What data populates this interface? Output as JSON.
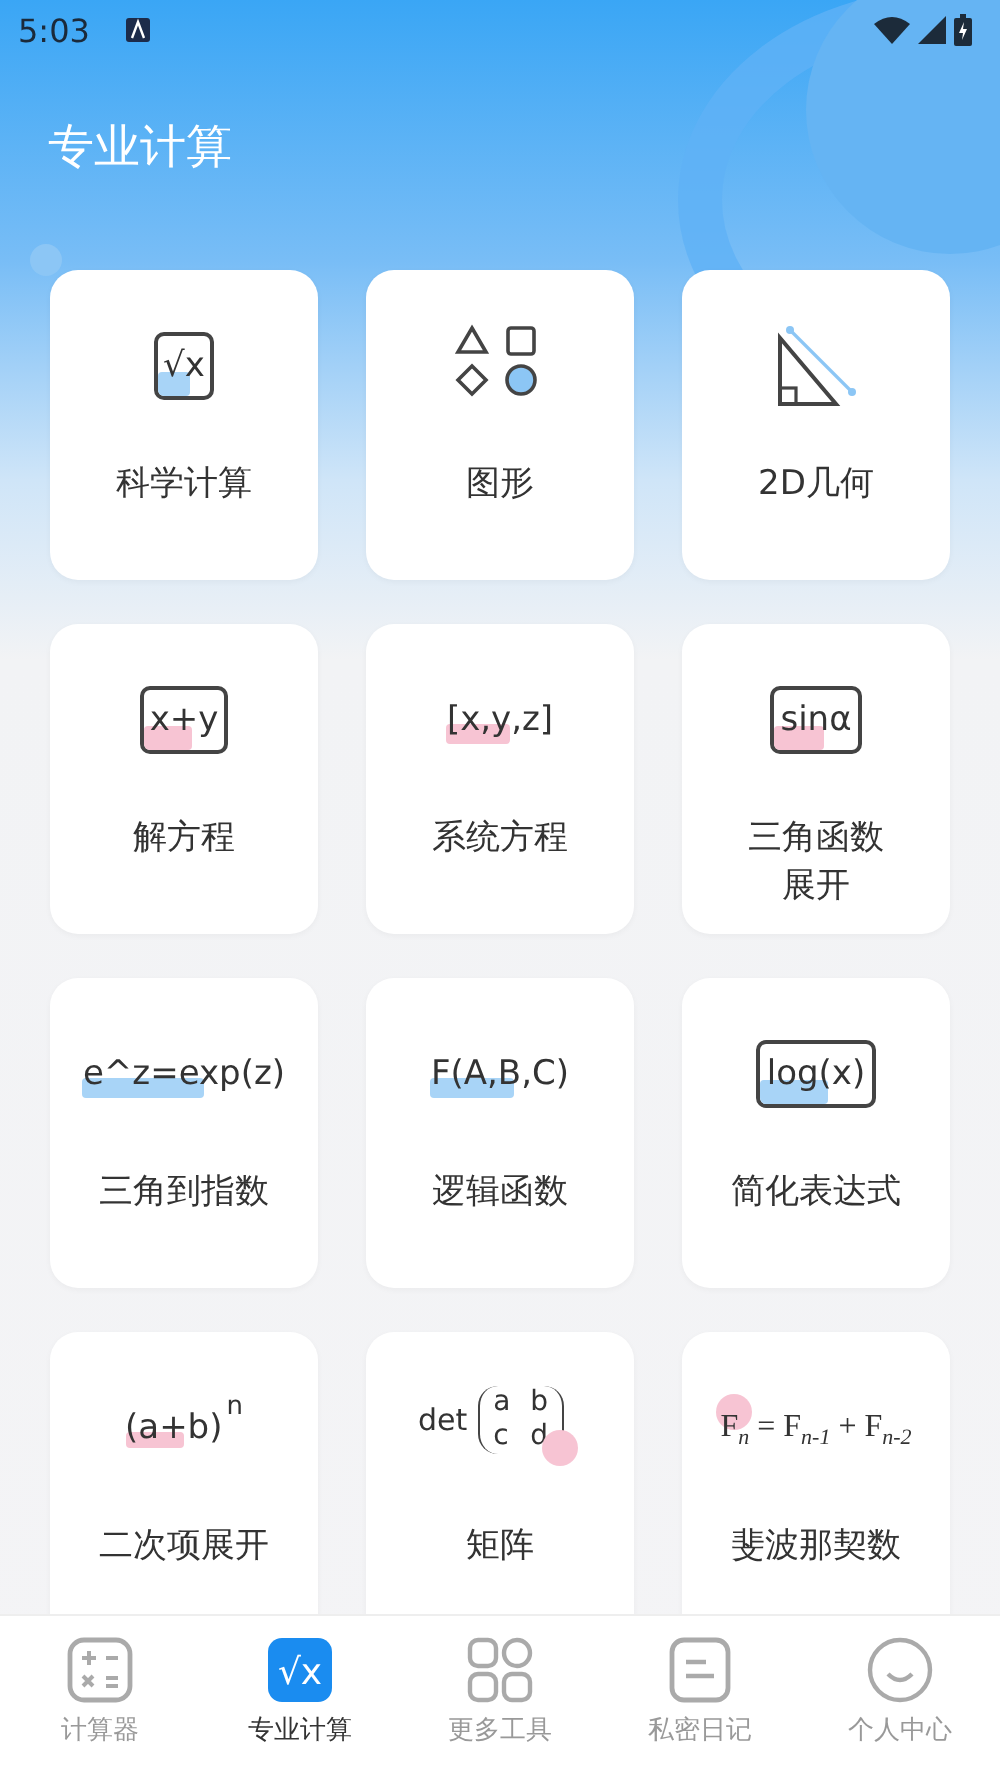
{
  "status_bar": {
    "time": "5:03"
  },
  "header": {
    "title": "专业计算"
  },
  "cards": [
    {
      "label": [
        "科学计算"
      ],
      "icon": {
        "kind": "boxed",
        "text": "√x",
        "color": "#a8d4f7"
      }
    },
    {
      "label": [
        "图形"
      ],
      "icon": {
        "kind": "shapes"
      }
    },
    {
      "label": [
        "2D几何"
      ],
      "icon": {
        "kind": "triangle"
      }
    },
    {
      "label": [
        "解方程"
      ],
      "icon": {
        "kind": "boxed",
        "text": "x+y",
        "color": "#f7c4d3"
      }
    },
    {
      "label": [
        "系统方程"
      ],
      "icon": {
        "kind": "plain",
        "text": "[x,y,z]",
        "color": "#f7c4d3"
      }
    },
    {
      "label": [
        "三角函数",
        "展开"
      ],
      "icon": {
        "kind": "boxed",
        "text": "sinα",
        "color": "#f7c4d3"
      }
    },
    {
      "label": [
        "三角到指数"
      ],
      "icon": {
        "kind": "plain",
        "text": "e^z=exp(z)",
        "color": "#a8d4f7"
      }
    },
    {
      "label": [
        "逻辑函数"
      ],
      "icon": {
        "kind": "plain",
        "text": "F(A,B,C)",
        "color": "#a8d4f7"
      }
    },
    {
      "label": [
        "简化表达式"
      ],
      "icon": {
        "kind": "boxed",
        "text": "log(x)",
        "color": "#a8d4f7"
      }
    },
    {
      "label": [
        "二次项展开"
      ],
      "icon": {
        "kind": "power",
        "base": "(a+b)",
        "exponent": "n",
        "color": "#f7c4d3"
      }
    },
    {
      "label": [
        "矩阵"
      ],
      "icon": {
        "kind": "matrix",
        "prefix": "det",
        "cells": [
          "a",
          "b",
          "c",
          "d"
        ],
        "color": "#f7c4d3"
      }
    },
    {
      "label": [
        "斐波那契数"
      ],
      "icon": {
        "kind": "formula",
        "text": "F$_{n}$ = F$_{n-1}$ + F$_{n-2}$",
        "color": "#f7c4d3"
      }
    }
  ],
  "nav": [
    {
      "label": "计算器",
      "kind": "calculator",
      "selected": false
    },
    {
      "label": "专业计算",
      "kind": "root",
      "icon_text": "√x",
      "selected": true
    },
    {
      "label": "更多工具",
      "kind": "grid",
      "selected": false
    },
    {
      "label": "私密日记",
      "kind": "note",
      "selected": false
    },
    {
      "label": "个人中心",
      "kind": "smile",
      "selected": false
    }
  ]
}
